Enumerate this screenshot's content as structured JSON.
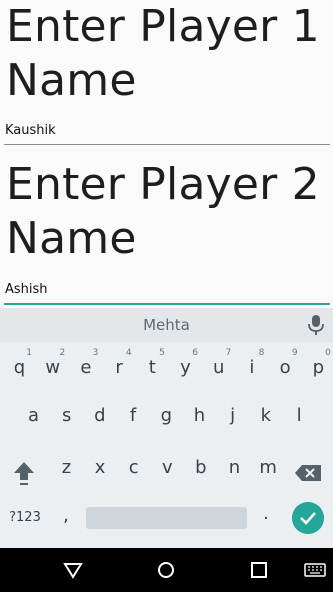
{
  "headings": {
    "player1": "Enter Player 1 Name",
    "player2": "Enter Player 2 Name"
  },
  "fields": {
    "player1_value": "Kaushik",
    "player2_value": "Ashish"
  },
  "keyboard": {
    "suggestion": "Mehta",
    "row1": [
      "q",
      "w",
      "e",
      "r",
      "t",
      "y",
      "u",
      "i",
      "o",
      "p"
    ],
    "row1_hints": [
      "1",
      "2",
      "3",
      "4",
      "5",
      "6",
      "7",
      "8",
      "9",
      "0"
    ],
    "row2": [
      "a",
      "s",
      "d",
      "f",
      "g",
      "h",
      "j",
      "k",
      "l"
    ],
    "row3": [
      "z",
      "x",
      "c",
      "v",
      "b",
      "n",
      "m"
    ],
    "symbols_label": "?123",
    "comma": ",",
    "period": "."
  },
  "colors": {
    "accent": "#26a69a",
    "keyboard_bg": "#eceff1",
    "navbar_bg": "#000000"
  },
  "icons": [
    "mic-icon",
    "shift-icon",
    "backspace-icon",
    "enter-check-icon",
    "back-icon",
    "home-icon",
    "recents-icon",
    "keyboard-switch-icon"
  ]
}
